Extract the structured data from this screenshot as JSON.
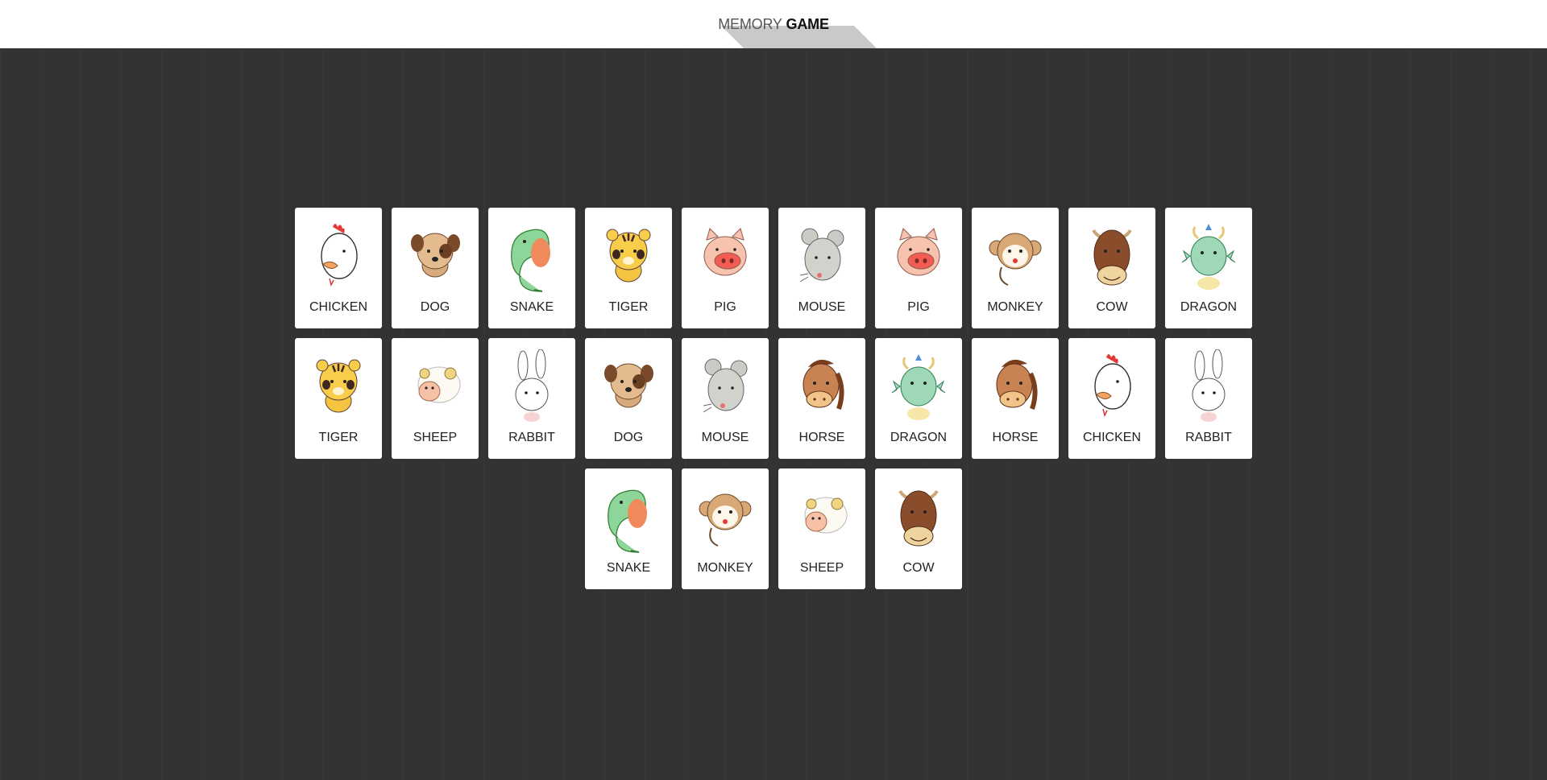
{
  "header": {
    "title_light": "MEMORY",
    "title_bold": "GAME"
  },
  "cards": [
    {
      "label": "CHICKEN",
      "icon": "chicken-icon"
    },
    {
      "label": "DOG",
      "icon": "dog-icon"
    },
    {
      "label": "SNAKE",
      "icon": "snake-icon"
    },
    {
      "label": "TIGER",
      "icon": "tiger-icon"
    },
    {
      "label": "PIG",
      "icon": "pig-icon"
    },
    {
      "label": "MOUSE",
      "icon": "mouse-icon"
    },
    {
      "label": "PIG",
      "icon": "pig-icon"
    },
    {
      "label": "MONKEY",
      "icon": "monkey-icon"
    },
    {
      "label": "COW",
      "icon": "cow-icon"
    },
    {
      "label": "DRAGON",
      "icon": "dragon-icon"
    },
    {
      "label": "TIGER",
      "icon": "tiger-icon"
    },
    {
      "label": "SHEEP",
      "icon": "sheep-icon"
    },
    {
      "label": "RABBIT",
      "icon": "rabbit-icon"
    },
    {
      "label": "DOG",
      "icon": "dog-icon"
    },
    {
      "label": "MOUSE",
      "icon": "mouse-icon"
    },
    {
      "label": "HORSE",
      "icon": "horse-icon"
    },
    {
      "label": "DRAGON",
      "icon": "dragon-icon"
    },
    {
      "label": "HORSE",
      "icon": "horse-icon"
    },
    {
      "label": "CHICKEN",
      "icon": "chicken-icon"
    },
    {
      "label": "RABBIT",
      "icon": "rabbit-icon"
    },
    {
      "label": "SNAKE",
      "icon": "snake-icon"
    },
    {
      "label": "MONKEY",
      "icon": "monkey-icon"
    },
    {
      "label": "SHEEP",
      "icon": "sheep-icon"
    },
    {
      "label": "COW",
      "icon": "cow-icon"
    }
  ]
}
